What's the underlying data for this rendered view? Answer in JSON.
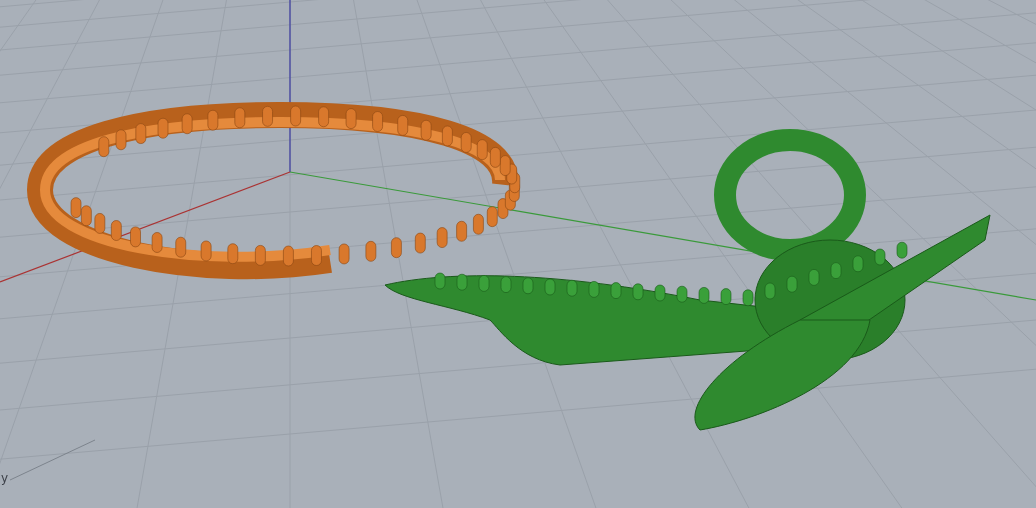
{
  "viewport": {
    "axis_label": "y"
  }
}
